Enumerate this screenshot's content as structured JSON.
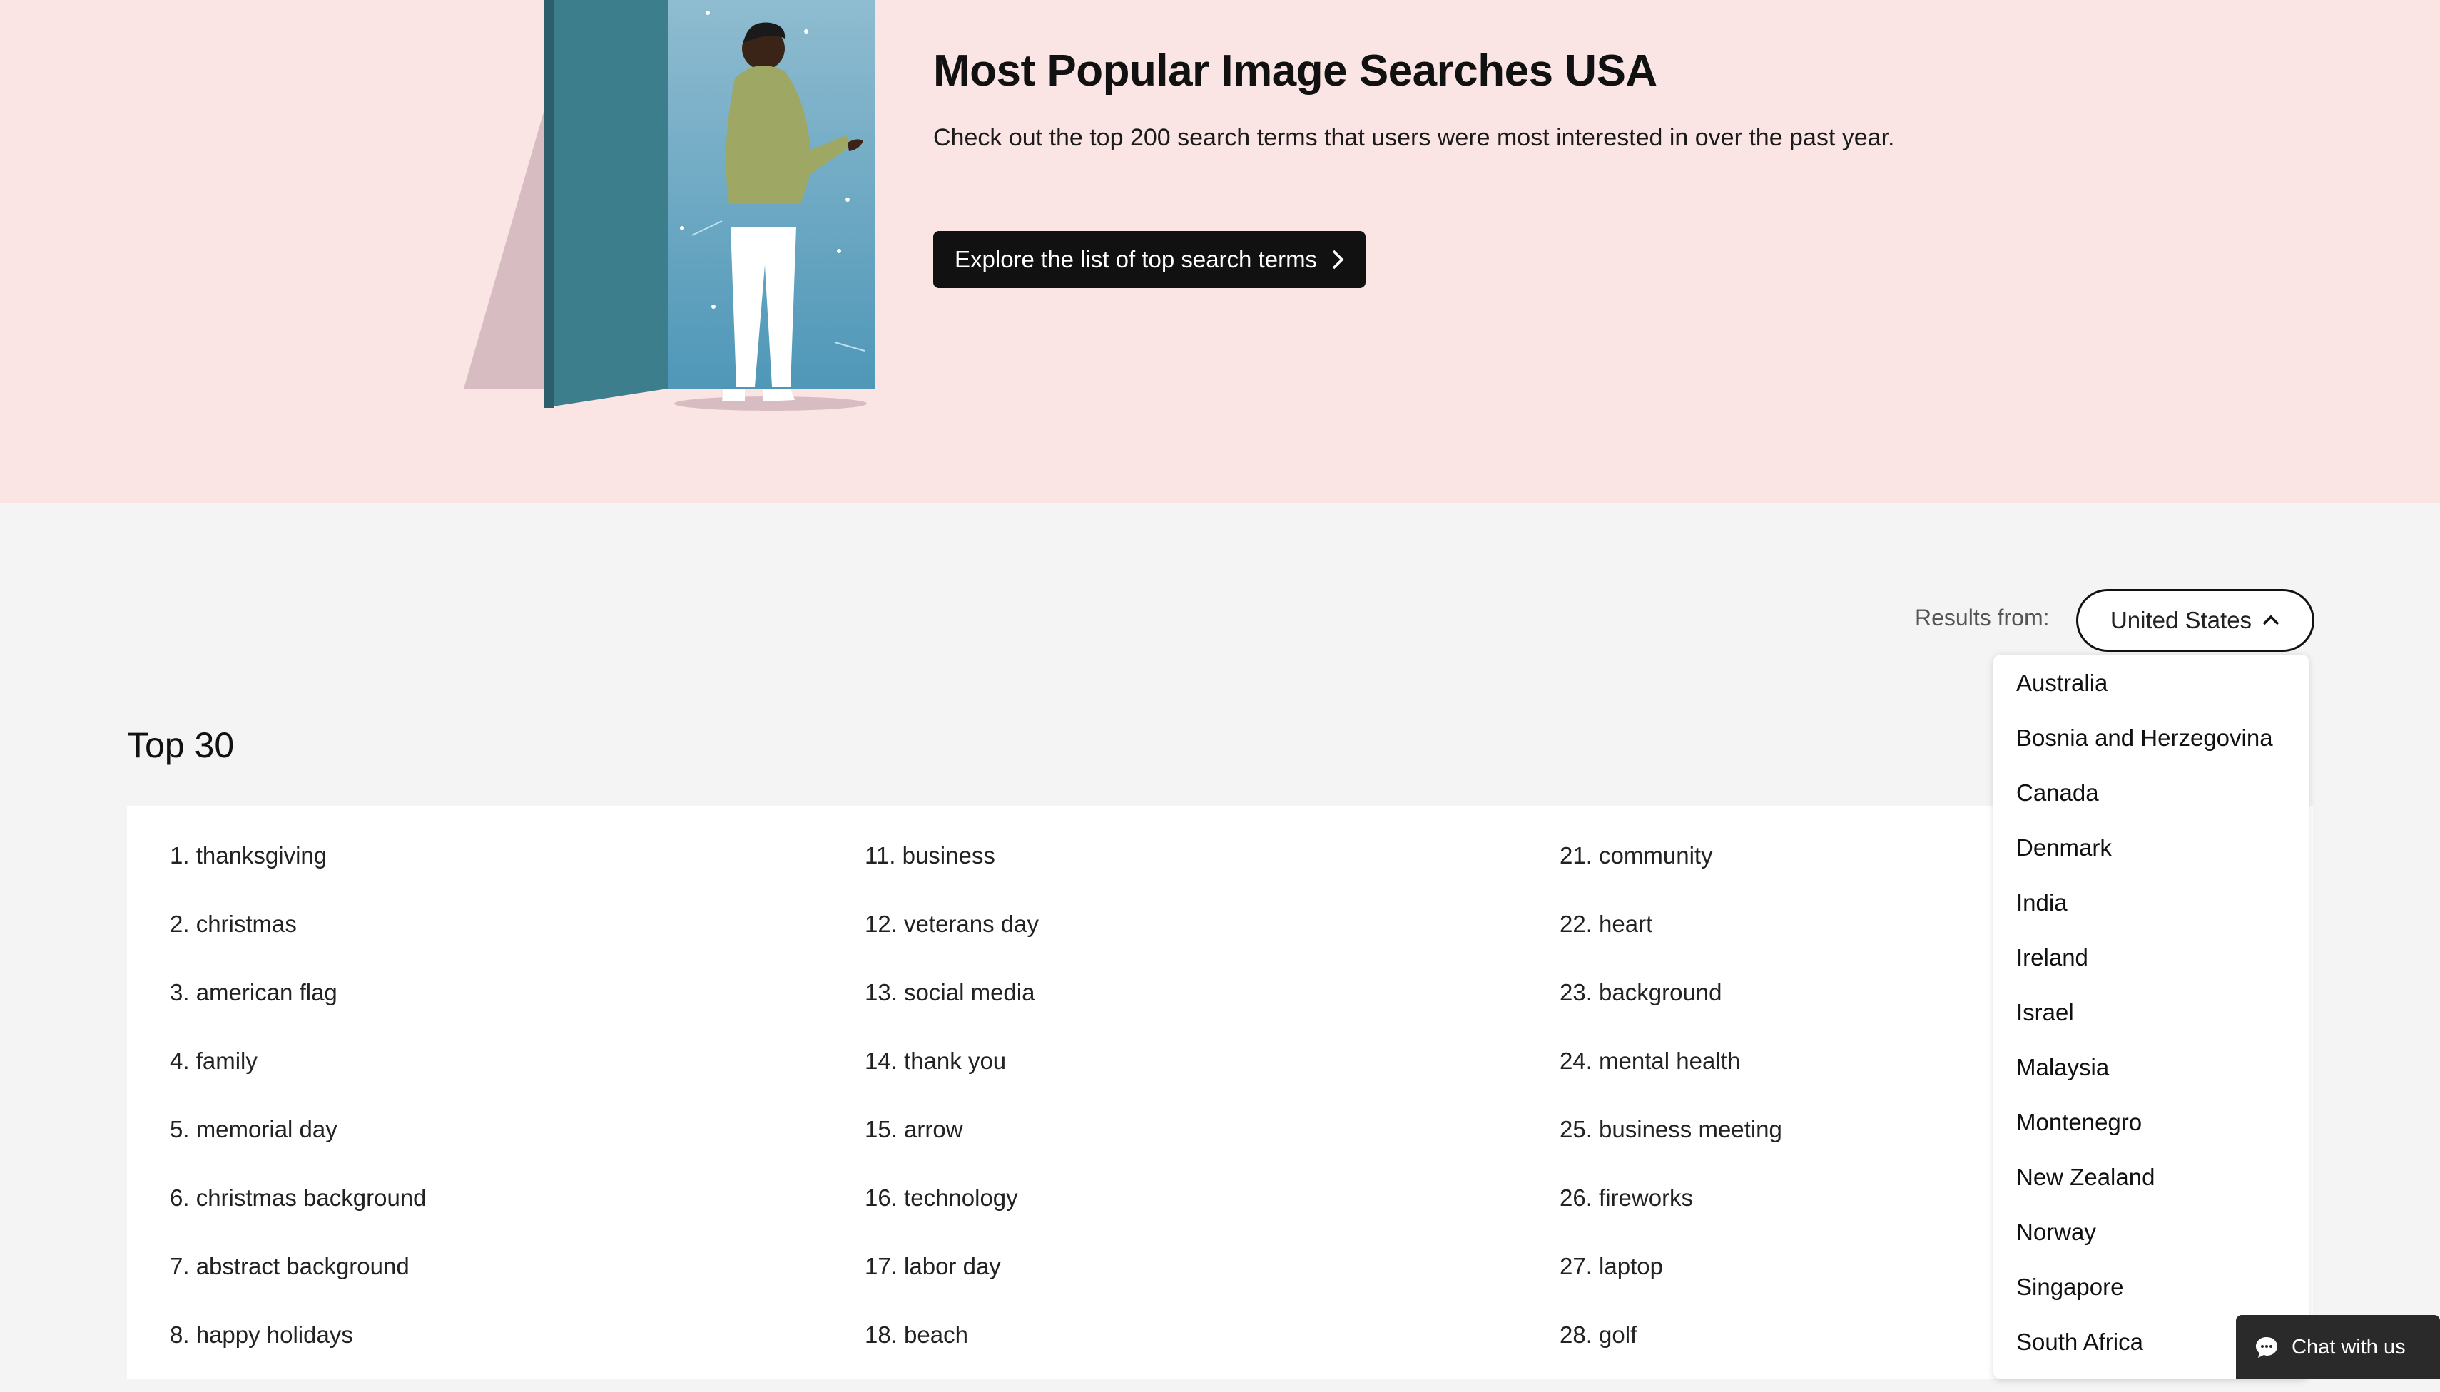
{
  "hero": {
    "title": "Most Popular Image Searches USA",
    "subtitle": "Check out the top 200 search terms that users were most interested in over the past year.",
    "cta_label": "Explore the list of top search terms"
  },
  "filter": {
    "label": "Results from:",
    "selected": "United States",
    "options": [
      "Australia",
      "Bosnia and Herzegovina",
      "Canada",
      "Denmark",
      "India",
      "Ireland",
      "Israel",
      "Malaysia",
      "Montenegro",
      "New Zealand",
      "Norway",
      "Singapore",
      "South Africa"
    ]
  },
  "top": {
    "title": "Top 30",
    "columns": [
      [
        "1. thanksgiving",
        "2. christmas",
        "3. american flag",
        "4. family",
        "5. memorial day",
        "6. christmas background",
        "7. abstract background",
        "8. happy holidays"
      ],
      [
        "11. business",
        "12. veterans day",
        "13. social media",
        "14. thank you",
        "15. arrow",
        "16. technology",
        "17. labor day",
        "18. beach"
      ],
      [
        "21. community",
        "22. heart",
        "23. background",
        "24. mental health",
        "25. business meeting",
        "26. fireworks",
        "27. laptop",
        "28. golf"
      ]
    ]
  },
  "chat": {
    "label": "Chat with us"
  }
}
